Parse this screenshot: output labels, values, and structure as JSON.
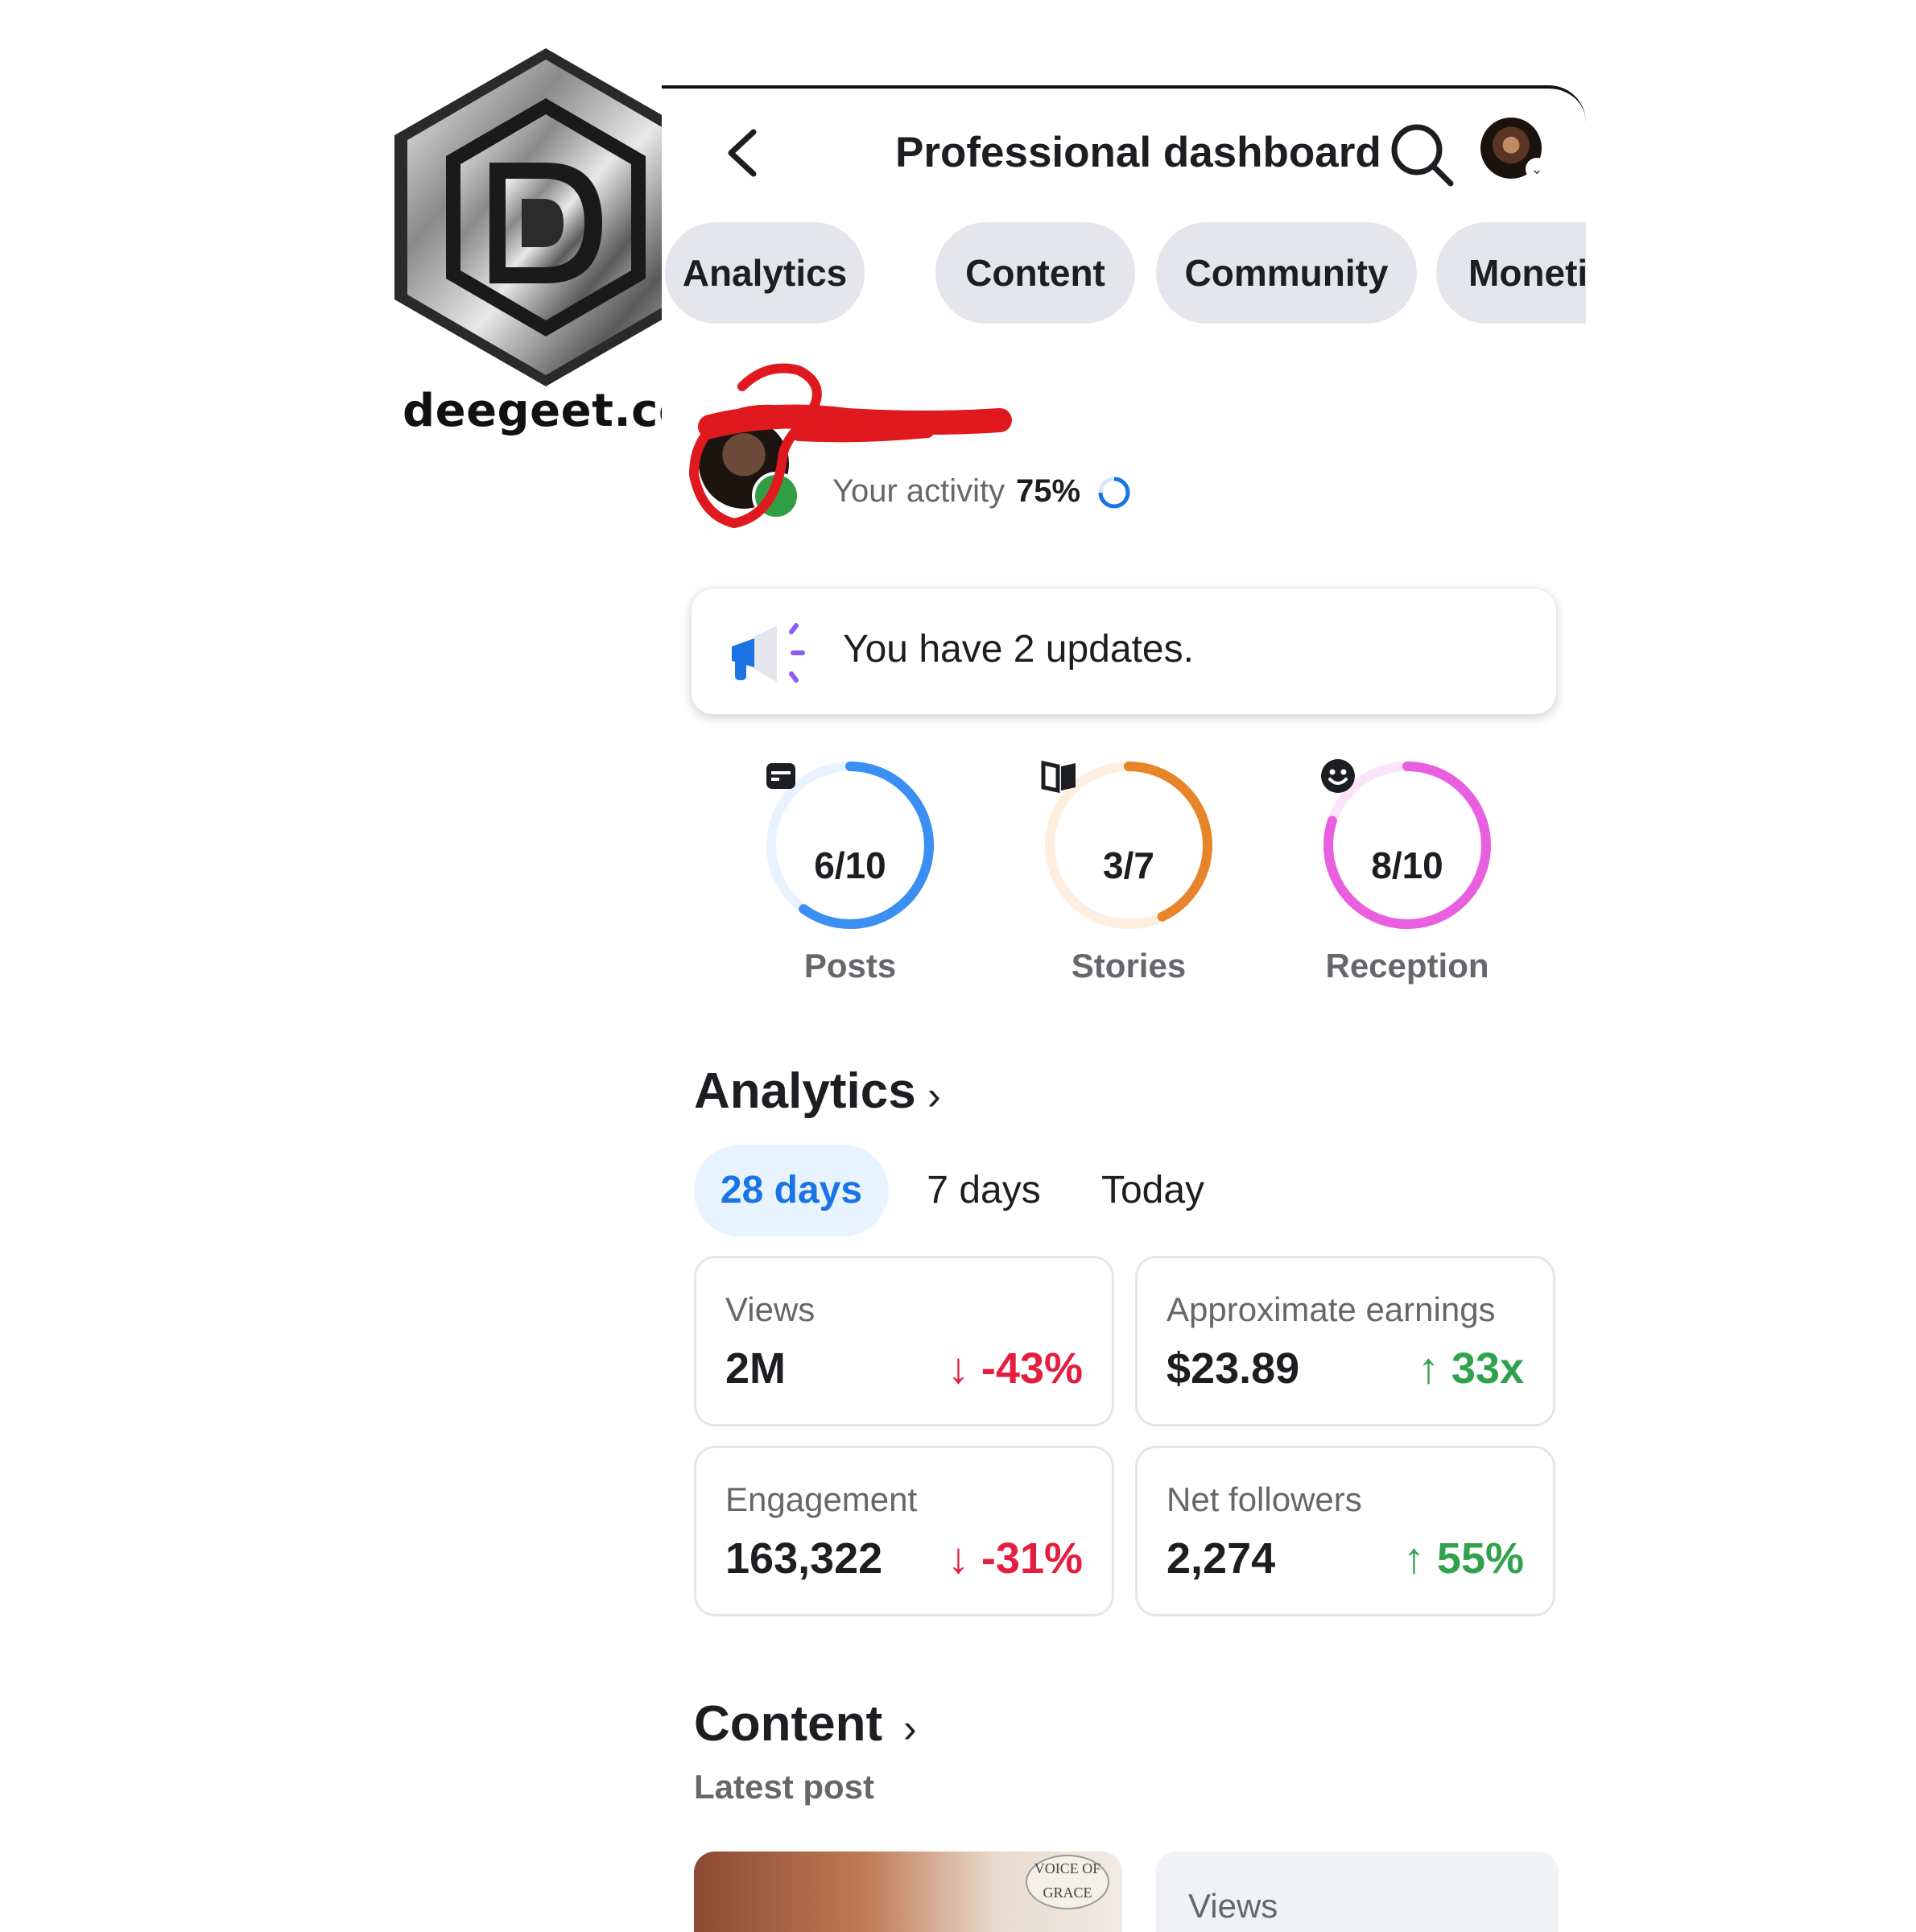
{
  "watermark": {
    "logo_text": "deegeet.com"
  },
  "header": {
    "title": "Professional dashboard"
  },
  "tabs": [
    {
      "label": "Analytics"
    },
    {
      "label": "Content"
    },
    {
      "label": "Community"
    },
    {
      "label": "Moneti"
    }
  ],
  "profile": {
    "activity_label": "Your activity",
    "activity_value": "75%"
  },
  "updates": {
    "text": "You have 2 updates."
  },
  "rings": [
    {
      "value": "6/10",
      "label": "Posts",
      "fraction": 0.6,
      "color": "#3b8ff3",
      "track": "#e7f3ff",
      "icon": "post-icon"
    },
    {
      "value": "3/7",
      "label": "Stories",
      "fraction": 0.43,
      "color": "#e8842a",
      "track": "#fdeee0",
      "icon": "book-icon"
    },
    {
      "value": "8/10",
      "label": "Reception",
      "fraction": 0.8,
      "color": "#e85fe0",
      "track": "#fbe4fa",
      "icon": "smiley-icon"
    }
  ],
  "analytics": {
    "heading": "Analytics",
    "ranges": [
      {
        "label": "28 days",
        "active": true
      },
      {
        "label": "7 days",
        "active": false
      },
      {
        "label": "Today",
        "active": false
      }
    ],
    "stats": [
      {
        "label": "Views",
        "value": "2M",
        "change": "↓ -43%",
        "trend": "down"
      },
      {
        "label": "Approximate earnings",
        "value": "$23.89",
        "change": "↑ 33x",
        "trend": "up"
      },
      {
        "label": "Engagement",
        "value": "163,322",
        "change": "↓ -31%",
        "trend": "down"
      },
      {
        "label": "Net followers",
        "value": "2,274",
        "change": "↑ 55%",
        "trend": "up"
      }
    ]
  },
  "content": {
    "heading": "Content",
    "latest_label": "Latest post",
    "post_badge": "VOICE OF GRACE",
    "views_label": "Views"
  },
  "colors": {
    "blue": "#1b74e4",
    "red": "#e41e3f",
    "green": "#31a24c"
  }
}
